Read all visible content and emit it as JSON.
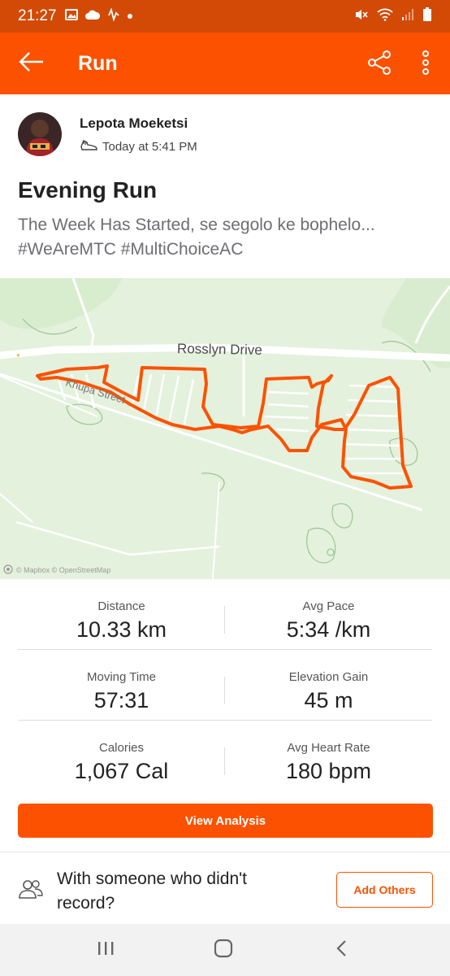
{
  "status_bar": {
    "time": "21:27",
    "left_icons": [
      "image-icon",
      "cloud-icon",
      "activity-icon",
      "dot-icon"
    ],
    "right_icons": [
      "mute-icon",
      "wifi-icon",
      "signal-icon",
      "battery-icon"
    ]
  },
  "app_bar": {
    "title": "Run",
    "icons": [
      "back-arrow-icon",
      "share-icon",
      "more-vertical-icon"
    ]
  },
  "athlete": {
    "name": "Lepota Moeketsi",
    "timestamp": "Today at 5:41 PM",
    "meta_icon": "shoe-icon"
  },
  "activity": {
    "title": "Evening Run",
    "description_line1": "The Week Has Started, se segolo ke bophelo...",
    "description_line2": "#WeAreMTC #MultiChoiceAC"
  },
  "map": {
    "road_label": "Rosslyn Drive",
    "street_label": "Khupa Street",
    "route_color": "#fc5200",
    "attribution": "© Mapbox © OpenStreetMap"
  },
  "stats": [
    {
      "left": {
        "label": "Distance",
        "value": "10.33 km"
      },
      "right": {
        "label": "Avg Pace",
        "value": "5:34 /km"
      }
    },
    {
      "left": {
        "label": "Moving Time",
        "value": "57:31"
      },
      "right": {
        "label": "Elevation Gain",
        "value": "45 m"
      }
    },
    {
      "left": {
        "label": "Calories",
        "value": "1,067 Cal"
      },
      "right": {
        "label": "Avg Heart Rate",
        "value": "180 bpm"
      }
    }
  ],
  "actions": {
    "view_analysis": "View Analysis",
    "with_others_text": "With someone who didn't record?",
    "add_others": "Add Others"
  },
  "nav": {
    "icons": [
      "recent-apps-icon",
      "home-icon",
      "back-icon"
    ]
  },
  "colors": {
    "brand": "#fc5200",
    "status_bar": "#d24a06",
    "map_background": "#e4f1dd"
  }
}
